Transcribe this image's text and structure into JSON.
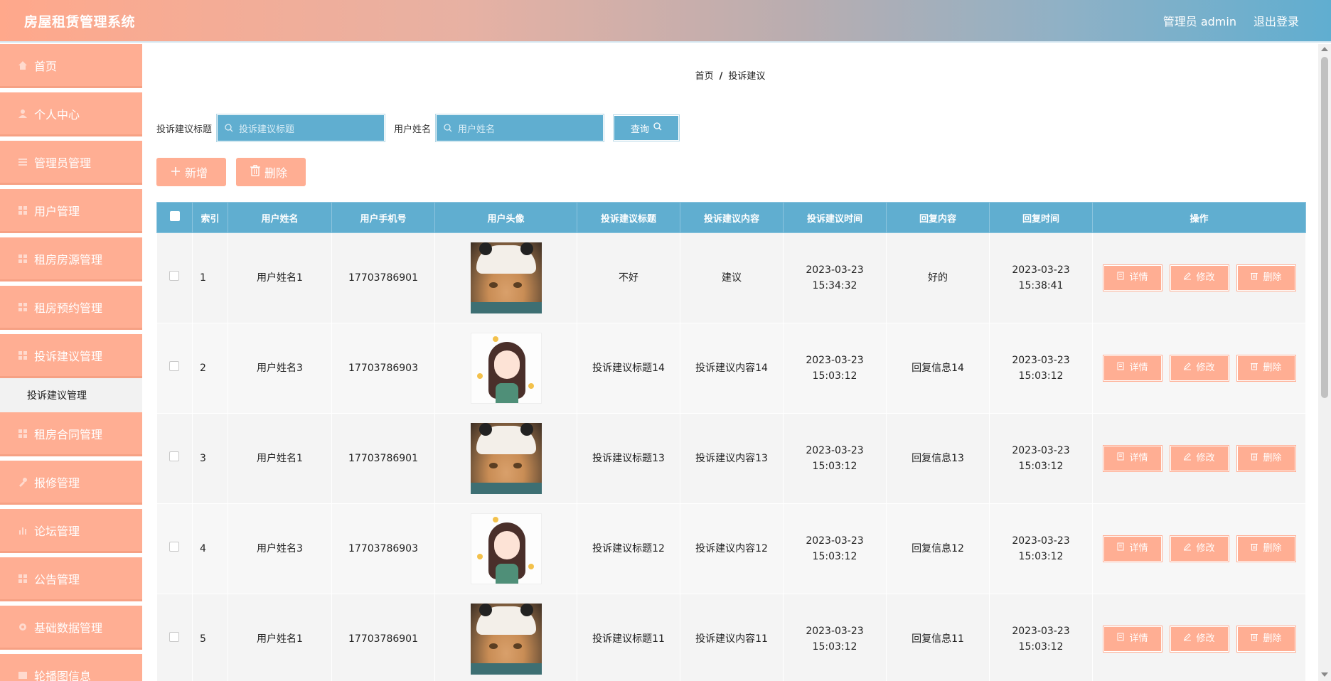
{
  "header": {
    "title": "房屋租赁管理系统",
    "user": "管理员 admin",
    "logout": "退出登录"
  },
  "sidebar": {
    "items": [
      {
        "label": "首页",
        "icon": "home-icon"
      },
      {
        "label": "个人中心",
        "icon": "user-icon"
      },
      {
        "label": "管理员管理",
        "icon": "list-icon"
      },
      {
        "label": "用户管理",
        "icon": "grid-icon"
      },
      {
        "label": "租房房源管理",
        "icon": "grid-icon"
      },
      {
        "label": "租房预约管理",
        "icon": "grid-icon"
      },
      {
        "label": "投诉建议管理",
        "icon": "grid-icon"
      },
      {
        "label": "租房合同管理",
        "icon": "grid-icon"
      },
      {
        "label": "报修管理",
        "icon": "wrench-icon"
      },
      {
        "label": "论坛管理",
        "icon": "chart-icon"
      },
      {
        "label": "公告管理",
        "icon": "grid-icon"
      },
      {
        "label": "基础数据管理",
        "icon": "gear-icon"
      },
      {
        "label": "轮播图信息",
        "icon": "image-icon"
      }
    ],
    "submenu": {
      "label": "投诉建议管理"
    }
  },
  "breadcrumb": {
    "home": "首页",
    "sep": "/",
    "current": "投诉建议"
  },
  "search": {
    "title_label": "投诉建议标题",
    "title_placeholder": "投诉建议标题",
    "name_label": "用户姓名",
    "name_placeholder": "用户姓名",
    "query_button": "查询"
  },
  "actions": {
    "add": "新增",
    "delete": "删除"
  },
  "table": {
    "headers": [
      "索引",
      "用户姓名",
      "用户手机号",
      "用户头像",
      "投诉建议标题",
      "投诉建议内容",
      "投诉建议时间",
      "回复内容",
      "回复时间",
      "操作"
    ],
    "rows": [
      {
        "idx": "1",
        "name": "用户姓名1",
        "phone": "17703786901",
        "avatar": "cat",
        "title": "不好",
        "content": "建议",
        "time": "2023-03-23 15:34:32",
        "reply": "好的",
        "reply_time": "2023-03-23 15:38:41"
      },
      {
        "idx": "2",
        "name": "用户姓名3",
        "phone": "17703786903",
        "avatar": "girl",
        "title": "投诉建议标题14",
        "content": "投诉建议内容14",
        "time": "2023-03-23 15:03:12",
        "reply": "回复信息14",
        "reply_time": "2023-03-23 15:03:12"
      },
      {
        "idx": "3",
        "name": "用户姓名1",
        "phone": "17703786901",
        "avatar": "cat",
        "title": "投诉建议标题13",
        "content": "投诉建议内容13",
        "time": "2023-03-23 15:03:12",
        "reply": "回复信息13",
        "reply_time": "2023-03-23 15:03:12"
      },
      {
        "idx": "4",
        "name": "用户姓名3",
        "phone": "17703786903",
        "avatar": "girl",
        "title": "投诉建议标题12",
        "content": "投诉建议内容12",
        "time": "2023-03-23 15:03:12",
        "reply": "回复信息12",
        "reply_time": "2023-03-23 15:03:12"
      },
      {
        "idx": "5",
        "name": "用户姓名1",
        "phone": "17703786901",
        "avatar": "cat",
        "title": "投诉建议标题11",
        "content": "投诉建议内容11",
        "time": "2023-03-23 15:03:12",
        "reply": "回复信息11",
        "reply_time": "2023-03-23 15:03:12"
      }
    ],
    "row_actions": {
      "detail": "详情",
      "edit": "修改",
      "delete": "删除"
    }
  },
  "colors": {
    "accent": "#ffae93",
    "primary": "#60aed0"
  }
}
